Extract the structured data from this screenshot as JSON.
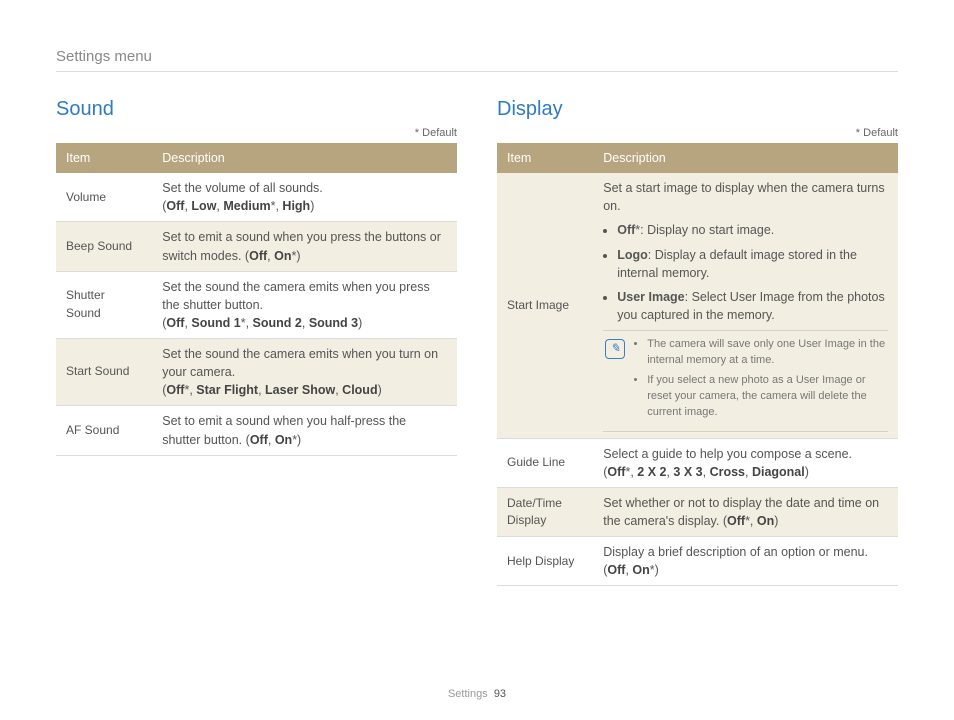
{
  "breadcrumb": "Settings menu",
  "default_note": "* Default",
  "headers": {
    "item": "Item",
    "description": "Description"
  },
  "sound": {
    "title": "Sound",
    "rows": [
      {
        "item": "Volume",
        "desc": "Set the volume of all sounds.",
        "options_raw": "(Off, Low, Medium*, High)",
        "options": [
          "Off",
          "Low",
          "Medium*",
          "High"
        ]
      },
      {
        "item": "Beep Sound",
        "desc": "Set to emit a sound when you press the buttons or switch modes.",
        "options_raw": "(Off, On*)",
        "options": [
          "Off",
          "On*"
        ]
      },
      {
        "item": "Shutter Sound",
        "desc": "Set the sound the camera emits when you press the shutter button.",
        "options_raw": "(Off, Sound 1*, Sound 2, Sound 3)",
        "options": [
          "Off",
          "Sound 1*",
          "Sound 2",
          "Sound 3"
        ]
      },
      {
        "item": "Start Sound",
        "desc": "Set the sound the camera emits when you turn on your camera.",
        "options_raw": "(Off*, Star Flight, Laser Show, Cloud)",
        "options": [
          "Off*",
          "Star Flight",
          "Laser Show",
          "Cloud"
        ]
      },
      {
        "item": "AF Sound",
        "desc": "Set to emit a sound when you half-press the shutter button.",
        "options_raw": "(Off, On*)",
        "options": [
          "Off",
          "On*"
        ]
      }
    ]
  },
  "display": {
    "title": "Display",
    "rows": [
      {
        "item": "Start Image",
        "desc": "Set a start image to display when the camera turns on.",
        "bullets": [
          {
            "label": "Off*",
            "text": ": Display no start image."
          },
          {
            "label": "Logo",
            "text": ": Display a default image stored in the internal memory."
          },
          {
            "label": "User Image",
            "text": ": Select User Image from the photos you captured in the memory."
          }
        ],
        "notes": [
          "The camera will save only one User Image in the internal memory at a time.",
          "If you select a new photo as a User Image or reset your camera, the camera will delete the current image."
        ]
      },
      {
        "item": "Guide Line",
        "desc": "Select a guide to help you compose a scene.",
        "options_raw": "(Off*, 2 X 2, 3 X 3, Cross, Diagonal)",
        "options": [
          "Off*",
          "2 X 2",
          "3 X 3",
          "Cross",
          "Diagonal"
        ]
      },
      {
        "item": "Date/Time Display",
        "desc": "Set whether or not to display the date and time on the camera's display.",
        "options_raw": "(Off*, On)",
        "options": [
          "Off*",
          "On"
        ]
      },
      {
        "item": "Help Display",
        "desc": "Display a brief description of an option or menu.",
        "options_raw": "(Off, On*)",
        "options": [
          "Off",
          "On*"
        ]
      }
    ]
  },
  "footer": {
    "label": "Settings",
    "page": "93"
  }
}
